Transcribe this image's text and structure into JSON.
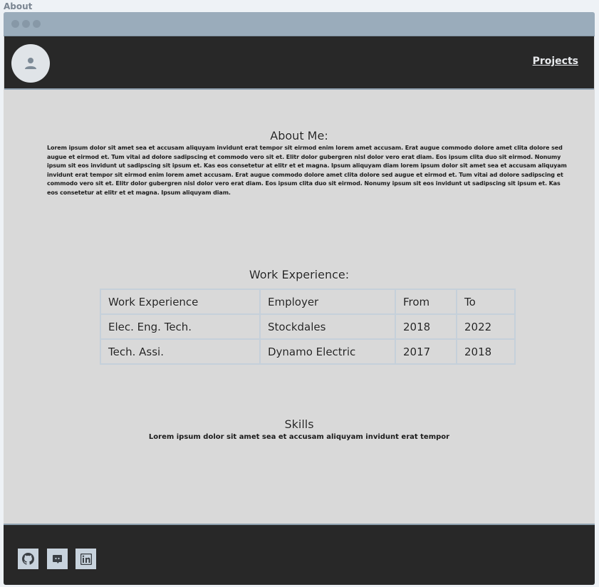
{
  "page": {
    "label": "About"
  },
  "navbar": {
    "projects_label": "Projects"
  },
  "about": {
    "title": "About Me:",
    "text": "Lorem ipsum dolor sit amet sea et accusam aliquyam invidunt erat tempor sit eirmod enim lorem amet accusam. Erat augue commodo dolore amet clita dolore sed augue et eirmod et. Tum vitai ad dolore sadipscing et commodo vero sit et. Elitr dolor gubergren nisl dolor vero erat diam. Eos ipsum clita duo sit eirmod. Nonumy ipsum sit eos invidunt ut sadipscing sit ipsum et. Kas eos consetetur at elitr et et magna. Ipsum aliquyam diam lorem ipsum dolor sit amet sea et accusam aliquyam invidunt erat tempor sit eirmod enim lorem amet accusam. Erat augue commodo dolore amet clita dolore sed augue et eirmod et. Tum vitai ad dolore sadipscing et commodo vero sit et. Elitr dolor gubergren nisl dolor vero erat diam. Eos ipsum clita duo sit eirmod. Nonumy ipsum sit eos invidunt ut sadipscing sit ipsum et. Kas eos consetetur at elitr et et magna. Ipsum aliquyam diam."
  },
  "work": {
    "title": "Work Experience:",
    "headers": [
      "Work Experience",
      "Employer",
      "From",
      "To"
    ],
    "rows": [
      [
        "Elec. Eng. Tech.",
        "Stockdales",
        "2018",
        "2022"
      ],
      [
        "Tech. Assi.",
        "Dynamo Electric",
        "2017",
        "2018"
      ]
    ]
  },
  "skills": {
    "title": "Skills",
    "text": "Lorem ipsum dolor sit amet sea et accusam aliquyam invidunt erat tempor"
  },
  "footer": {
    "icons": [
      "github-icon",
      "discord-icon",
      "linkedin-icon"
    ]
  },
  "colors": {
    "titlebar": "#9aacbb",
    "navbar": "#282828",
    "main": "#d9d9d9",
    "accent_border": "#8fa1b0"
  }
}
